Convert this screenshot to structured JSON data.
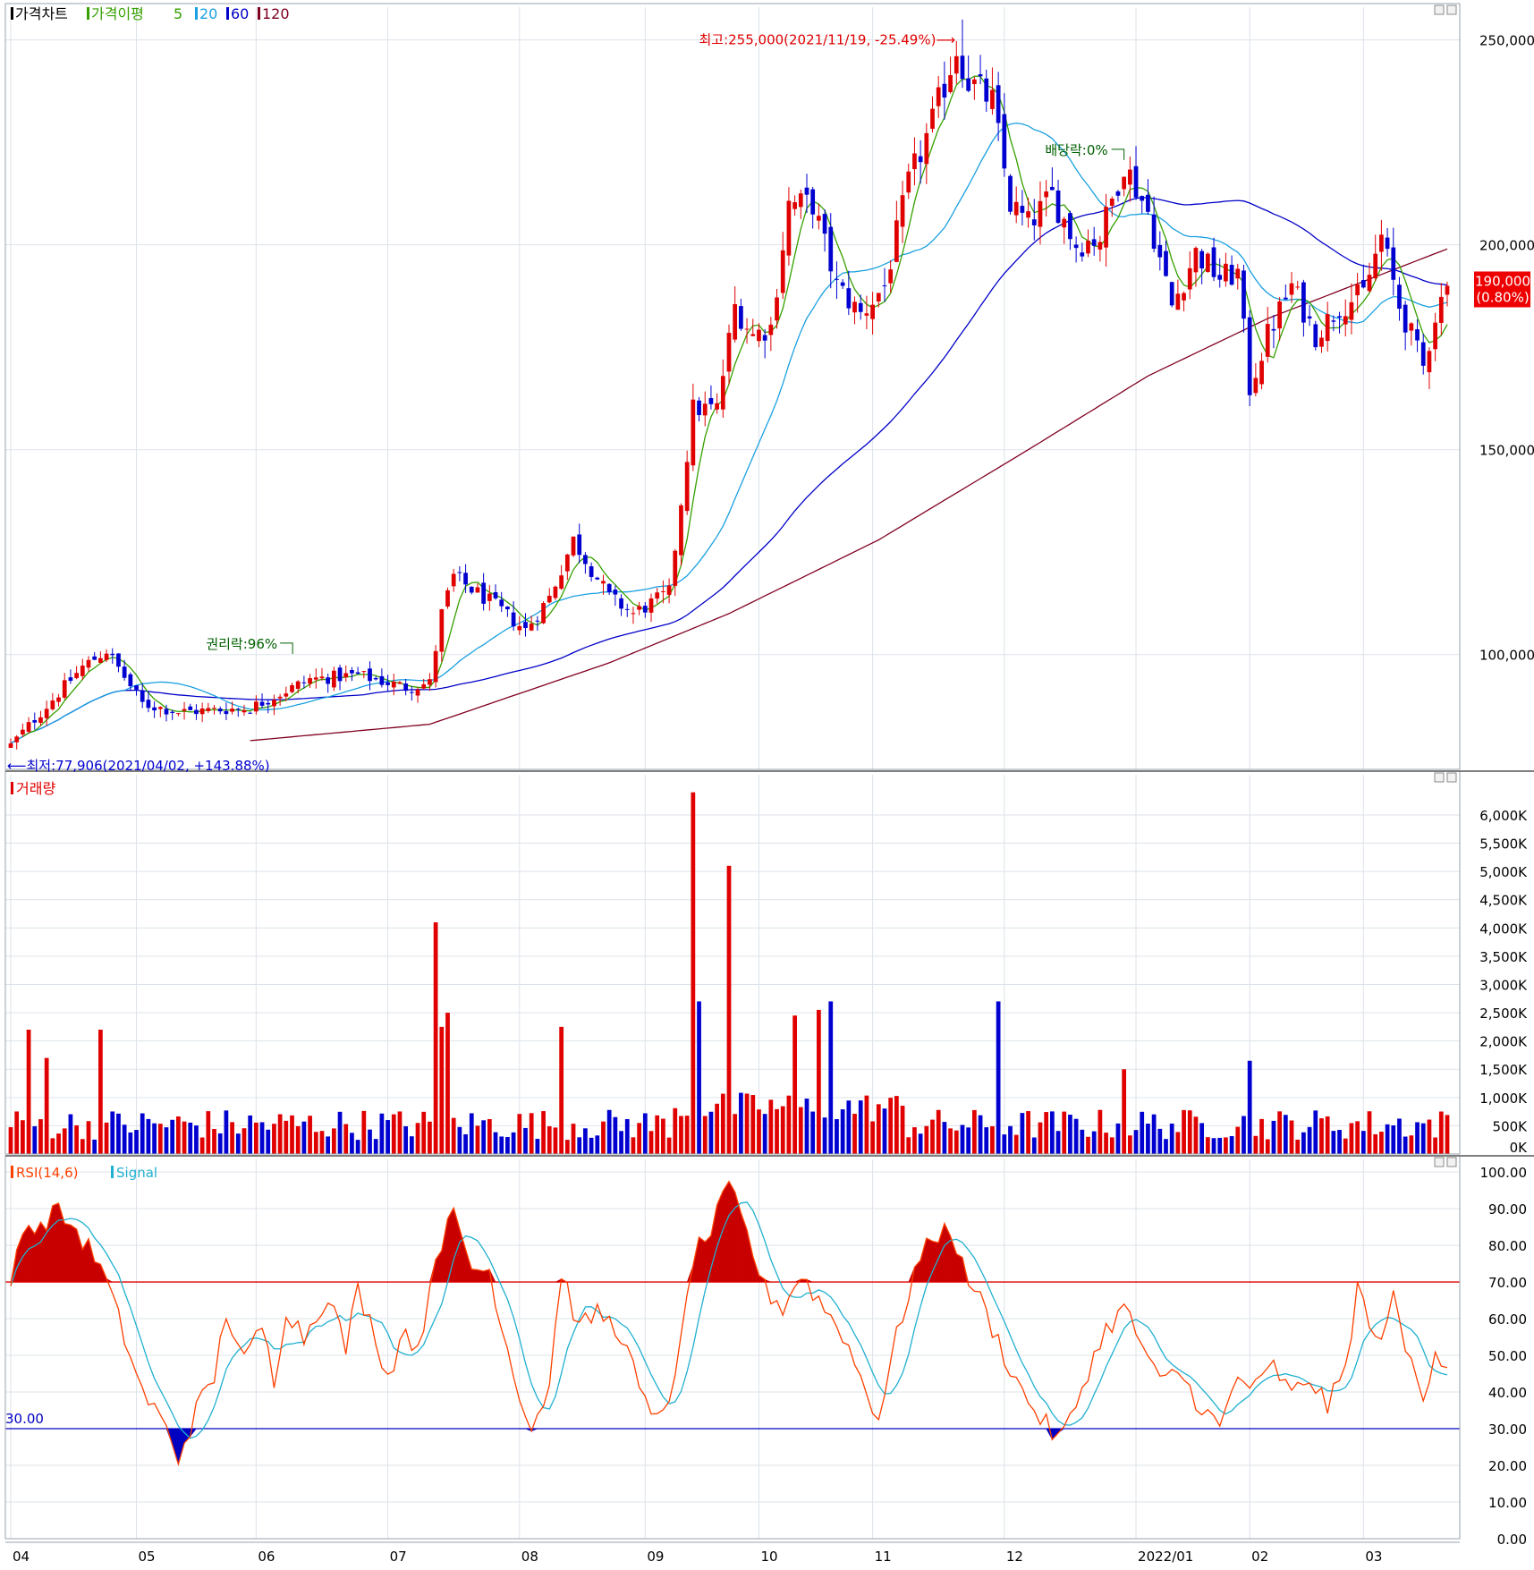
{
  "panels": {
    "price": {
      "legend": [
        "가격차트",
        "가격이평",
        "5",
        "20",
        "60",
        "120"
      ],
      "ticks": [
        {
          "v": 100000,
          "label": "100,000"
        },
        {
          "v": 150000,
          "label": "150,000"
        },
        {
          "v": 200000,
          "label": "200,000"
        },
        {
          "v": 250000,
          "label": "250,000"
        }
      ],
      "ylim": [
        72000,
        258000
      ],
      "current_price": "190,000",
      "current_change": "(0.80%)",
      "annotation_high": "최고:255,000(2021/11/19, -25.49%)⟶",
      "annotation_low": "⟵최저:77,906(2021/04/02, +143.88%)",
      "annotation_rights": "권리락:96%",
      "annotation_dividend": "배당락:0%"
    },
    "volume": {
      "legend": "거래량",
      "ticks": [
        {
          "v": 0,
          "label": "0K"
        },
        {
          "v": 500,
          "label": "500K"
        },
        {
          "v": 1000,
          "label": "1,000K"
        },
        {
          "v": 1500,
          "label": "1,500K"
        },
        {
          "v": 2000,
          "label": "2,000K"
        },
        {
          "v": 2500,
          "label": "2,500K"
        },
        {
          "v": 3000,
          "label": "3,000K"
        },
        {
          "v": 3500,
          "label": "3,500K"
        },
        {
          "v": 4000,
          "label": "4,000K"
        },
        {
          "v": 4500,
          "label": "4,500K"
        },
        {
          "v": 5000,
          "label": "5,000K"
        },
        {
          "v": 5500,
          "label": "5,500K"
        },
        {
          "v": 6000,
          "label": "6,000K"
        }
      ],
      "ylim": [
        0,
        6300
      ]
    },
    "rsi": {
      "legend": [
        "RSI(14,6)",
        "Signal"
      ],
      "ticks": [
        {
          "v": 0,
          "label": "0.00"
        },
        {
          "v": 10,
          "label": "10.00"
        },
        {
          "v": 20,
          "label": "20.00"
        },
        {
          "v": 30,
          "label": "30.00"
        },
        {
          "v": 40,
          "label": "40.00"
        },
        {
          "v": 50,
          "label": "50.00"
        },
        {
          "v": 60,
          "label": "60.00"
        },
        {
          "v": 70,
          "label": "70.00"
        },
        {
          "v": 80,
          "label": "80.00"
        },
        {
          "v": 90,
          "label": "90.00"
        },
        {
          "v": 100,
          "label": "100.00"
        }
      ],
      "ylim": [
        0,
        101
      ],
      "level_high": 70,
      "level_low": 30,
      "level_low_label": "30.00"
    }
  },
  "x_axis": [
    {
      "label": "04",
      "day": 0
    },
    {
      "label": "05",
      "day": 21
    },
    {
      "label": "06",
      "day": 41
    },
    {
      "label": "07",
      "day": 63
    },
    {
      "label": "08",
      "day": 85
    },
    {
      "label": "09",
      "day": 106
    },
    {
      "label": "10",
      "day": 125
    },
    {
      "label": "11",
      "day": 144
    },
    {
      "label": "12",
      "day": 166
    },
    {
      "label": "2022/01",
      "day": 188
    },
    {
      "label": "02",
      "day": 207
    },
    {
      "label": "03",
      "day": 226
    }
  ],
  "colors": {
    "up": "#e00000",
    "down": "#0000d0",
    "ma5": "#36a000",
    "ma20": "#1aa0e0",
    "ma60": "#0000c8",
    "ma120": "#800020",
    "rsi": "#ff4000",
    "signal": "#20b0d0",
    "grid": "#dde3ea",
    "axis_text": "#000000"
  },
  "chart_data": {
    "type": "candlestick",
    "period": "2021/04 - 2022/03",
    "total_days": 240,
    "key_points": [
      {
        "day": 0,
        "price": 77906,
        "note": "최저"
      },
      {
        "day": 12,
        "price": 97000
      },
      {
        "day": 16,
        "price": 101000
      },
      {
        "day": 22,
        "price": 88000
      },
      {
        "day": 28,
        "price": 86000
      },
      {
        "day": 40,
        "price": 87000
      },
      {
        "day": 50,
        "price": 94000
      },
      {
        "day": 58,
        "price": 95000
      },
      {
        "day": 66,
        "price": 92000
      },
      {
        "day": 70,
        "price": 93000
      },
      {
        "day": 72,
        "price": 110000
      },
      {
        "day": 74,
        "price": 119000
      },
      {
        "day": 80,
        "price": 113000
      },
      {
        "day": 86,
        "price": 106000
      },
      {
        "day": 90,
        "price": 114000
      },
      {
        "day": 94,
        "price": 128000
      },
      {
        "day": 100,
        "price": 114000
      },
      {
        "day": 104,
        "price": 110000
      },
      {
        "day": 110,
        "price": 115000
      },
      {
        "day": 114,
        "price": 160000
      },
      {
        "day": 118,
        "price": 160000
      },
      {
        "day": 121,
        "price": 185000
      },
      {
        "day": 124,
        "price": 178000
      },
      {
        "day": 127,
        "price": 180000
      },
      {
        "day": 130,
        "price": 210000
      },
      {
        "day": 134,
        "price": 210000
      },
      {
        "day": 138,
        "price": 190000
      },
      {
        "day": 142,
        "price": 183000
      },
      {
        "day": 146,
        "price": 190000
      },
      {
        "day": 150,
        "price": 215000
      },
      {
        "day": 154,
        "price": 230000
      },
      {
        "day": 158,
        "price": 248000
      },
      {
        "day": 160,
        "price": 240000
      },
      {
        "day": 164,
        "price": 235000
      },
      {
        "day": 167,
        "price": 210000
      },
      {
        "day": 170,
        "price": 205000
      },
      {
        "day": 174,
        "price": 212000
      },
      {
        "day": 178,
        "price": 200000
      },
      {
        "day": 182,
        "price": 202000
      },
      {
        "day": 186,
        "price": 220000
      },
      {
        "day": 190,
        "price": 208000
      },
      {
        "day": 194,
        "price": 185000
      },
      {
        "day": 198,
        "price": 198000
      },
      {
        "day": 202,
        "price": 192000
      },
      {
        "day": 205,
        "price": 193000
      },
      {
        "day": 207,
        "price": 165000
      },
      {
        "day": 210,
        "price": 178000
      },
      {
        "day": 214,
        "price": 190000
      },
      {
        "day": 218,
        "price": 178000
      },
      {
        "day": 222,
        "price": 185000
      },
      {
        "day": 226,
        "price": 188000
      },
      {
        "day": 229,
        "price": 202000
      },
      {
        "day": 232,
        "price": 185000
      },
      {
        "day": 234,
        "price": 178000
      },
      {
        "day": 236,
        "price": 170000
      },
      {
        "day": 238,
        "price": 183000
      },
      {
        "day": 240,
        "price": 190000
      }
    ],
    "high": {
      "day": 159,
      "price": 255000,
      "date": "2021/11/19"
    },
    "low": {
      "day": 0,
      "price": 77906,
      "date": "2021/04/02"
    },
    "last_close": 190000,
    "volume_spikes": [
      {
        "day": 3,
        "volume": 2200
      },
      {
        "day": 6,
        "volume": 1700
      },
      {
        "day": 15,
        "volume": 2200
      },
      {
        "day": 71,
        "volume": 4100
      },
      {
        "day": 72,
        "volume": 2250
      },
      {
        "day": 73,
        "volume": 2500
      },
      {
        "day": 92,
        "volume": 2250
      },
      {
        "day": 114,
        "volume": 6400
      },
      {
        "day": 115,
        "volume": 2700
      },
      {
        "day": 120,
        "volume": 5100
      },
      {
        "day": 131,
        "volume": 2450
      },
      {
        "day": 135,
        "volume": 2550
      },
      {
        "day": 137,
        "volume": 2700
      },
      {
        "day": 165,
        "volume": 2700
      },
      {
        "day": 186,
        "volume": 1500
      },
      {
        "day": 207,
        "volume": 1650
      }
    ],
    "rsi_points": [
      {
        "day": 0,
        "v": 70
      },
      {
        "day": 2,
        "v": 86
      },
      {
        "day": 5,
        "v": 84
      },
      {
        "day": 7,
        "v": 90
      },
      {
        "day": 10,
        "v": 86
      },
      {
        "day": 14,
        "v": 77
      },
      {
        "day": 16,
        "v": 70
      },
      {
        "day": 19,
        "v": 55
      },
      {
        "day": 22,
        "v": 40
      },
      {
        "day": 25,
        "v": 33
      },
      {
        "day": 28,
        "v": 22
      },
      {
        "day": 31,
        "v": 35
      },
      {
        "day": 34,
        "v": 44
      },
      {
        "day": 36,
        "v": 62
      },
      {
        "day": 39,
        "v": 48
      },
      {
        "day": 42,
        "v": 58
      },
      {
        "day": 44,
        "v": 43
      },
      {
        "day": 46,
        "v": 63
      },
      {
        "day": 49,
        "v": 55
      },
      {
        "day": 53,
        "v": 67
      },
      {
        "day": 56,
        "v": 52
      },
      {
        "day": 58,
        "v": 68
      },
      {
        "day": 61,
        "v": 55
      },
      {
        "day": 63,
        "v": 44
      },
      {
        "day": 66,
        "v": 58
      },
      {
        "day": 68,
        "v": 50
      },
      {
        "day": 71,
        "v": 78
      },
      {
        "day": 74,
        "v": 88
      },
      {
        "day": 77,
        "v": 74
      },
      {
        "day": 80,
        "v": 73
      },
      {
        "day": 84,
        "v": 45
      },
      {
        "day": 87,
        "v": 30
      },
      {
        "day": 90,
        "v": 42
      },
      {
        "day": 92,
        "v": 73
      },
      {
        "day": 95,
        "v": 57
      },
      {
        "day": 98,
        "v": 62
      },
      {
        "day": 102,
        "v": 56
      },
      {
        "day": 105,
        "v": 41
      },
      {
        "day": 107,
        "v": 32
      },
      {
        "day": 111,
        "v": 42
      },
      {
        "day": 114,
        "v": 77
      },
      {
        "day": 117,
        "v": 84
      },
      {
        "day": 120,
        "v": 96
      },
      {
        "day": 123,
        "v": 83
      },
      {
        "day": 126,
        "v": 68
      },
      {
        "day": 129,
        "v": 63
      },
      {
        "day": 132,
        "v": 72
      },
      {
        "day": 135,
        "v": 65
      },
      {
        "day": 139,
        "v": 56
      },
      {
        "day": 143,
        "v": 40
      },
      {
        "day": 145,
        "v": 33
      },
      {
        "day": 148,
        "v": 55
      },
      {
        "day": 151,
        "v": 73
      },
      {
        "day": 154,
        "v": 82
      },
      {
        "day": 157,
        "v": 85
      },
      {
        "day": 159,
        "v": 74
      },
      {
        "day": 162,
        "v": 65
      },
      {
        "day": 166,
        "v": 50
      },
      {
        "day": 169,
        "v": 40
      },
      {
        "day": 172,
        "v": 33
      },
      {
        "day": 175,
        "v": 27
      },
      {
        "day": 177,
        "v": 32
      },
      {
        "day": 180,
        "v": 46
      },
      {
        "day": 183,
        "v": 57
      },
      {
        "day": 186,
        "v": 63
      },
      {
        "day": 189,
        "v": 53
      },
      {
        "day": 192,
        "v": 42
      },
      {
        "day": 195,
        "v": 46
      },
      {
        "day": 198,
        "v": 38
      },
      {
        "day": 202,
        "v": 30
      },
      {
        "day": 205,
        "v": 44
      },
      {
        "day": 208,
        "v": 41
      },
      {
        "day": 211,
        "v": 47
      },
      {
        "day": 214,
        "v": 39
      },
      {
        "day": 217,
        "v": 44
      },
      {
        "day": 220,
        "v": 36
      },
      {
        "day": 223,
        "v": 46
      },
      {
        "day": 225,
        "v": 69
      },
      {
        "day": 228,
        "v": 53
      },
      {
        "day": 231,
        "v": 65
      },
      {
        "day": 233,
        "v": 52
      },
      {
        "day": 236,
        "v": 39
      },
      {
        "day": 238,
        "v": 52
      },
      {
        "day": 240,
        "v": 47
      }
    ]
  }
}
